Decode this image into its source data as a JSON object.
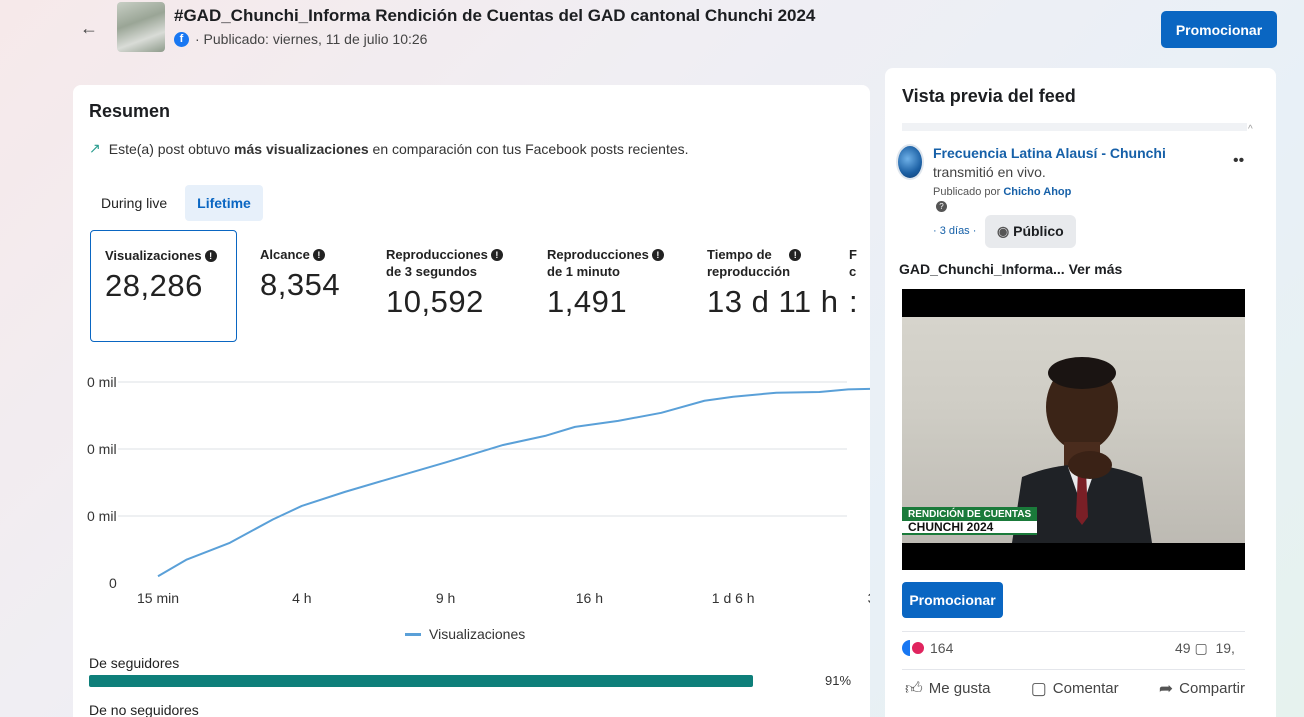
{
  "header": {
    "title": "#GAD_Chunchi_Informa Rendición de Cuentas del GAD cantonal Chunchi 2024",
    "subtitle": "· Publicado: viernes, 11 de julio 10:26",
    "back_icon": "arrow-left-icon",
    "promote_label": "Promocionar"
  },
  "summary": {
    "title": "Resumen",
    "insight_prefix": "Este(a) post obtuvo ",
    "insight_bold": "más visualizaciones",
    "insight_suffix": " en comparación con tus Facebook posts recientes.",
    "tabs": [
      {
        "label": "During live",
        "active": false
      },
      {
        "label": "Lifetime",
        "active": true
      }
    ],
    "metrics": [
      {
        "label": "Visualizaciones",
        "value": "28,286"
      },
      {
        "label": "Alcance",
        "value": "8,354"
      },
      {
        "label": "Reproducciones de 3 segundos",
        "line1": "Reproducciones",
        "line2": "de 3 segundos",
        "value": "10,592"
      },
      {
        "label": "Reproducciones de 1 minuto",
        "line1": "Reproducciones",
        "line2": "de 1 minuto",
        "value": "1,491"
      },
      {
        "label": "Tiempo de reproducción",
        "line1": "Tiempo de",
        "line2": "reproducción",
        "value": "13 d 11 h"
      },
      {
        "label": "F",
        "line1": "F",
        "line2": "c",
        "value": ":"
      }
    ],
    "followers_label": "De seguidores",
    "followers_pct_value": 91,
    "followers_pct_text": "91%",
    "non_followers_label": "De no seguidores"
  },
  "chart_data": {
    "type": "line",
    "ytick_labels": [
      "0",
      "0 mil",
      "0 mil",
      "0 mil"
    ],
    "ytick_values": [
      0,
      10000,
      20000,
      30000
    ],
    "ylim": [
      0,
      30000
    ],
    "xtick_labels": [
      "15 min",
      "4 h",
      "9 h",
      "16 h",
      "1 d 6 h",
      "3 c"
    ],
    "xtick_positions": [
      0,
      1,
      2,
      3,
      4,
      5
    ],
    "x": [
      0,
      0.2,
      0.5,
      0.8,
      1.0,
      1.3,
      1.6,
      2.0,
      2.4,
      2.7,
      2.9,
      3.2,
      3.5,
      3.8,
      4.0,
      4.3,
      4.6,
      4.8,
      5.0
    ],
    "y": [
      1000,
      3500,
      6000,
      9500,
      11500,
      13600,
      15500,
      18000,
      20600,
      22000,
      23300,
      24200,
      25400,
      27200,
      27800,
      28400,
      28500,
      28900,
      29000
    ],
    "series": [
      {
        "name": "Visualizaciones",
        "color": "#5aa0d8"
      }
    ],
    "grid": true,
    "legend_position": "bottom"
  },
  "feed": {
    "title": "Vista previa del feed",
    "page_name": "Frecuencia Latina Alausí - Chunchi",
    "live_text": "transmitió en vivo.",
    "published_by_prefix": "Publicado por ",
    "published_by_name": "Chicho Ahop",
    "age": "· 3 días ·",
    "audience": "Público",
    "caption": "GAD_Chunchi_Informa...",
    "see_more": "Ver más",
    "banner_line1": "RENDICIÓN DE CUENTAS",
    "banner_line2": "CHUNCHI 2024",
    "promote_label": "Promocionar",
    "reactions_count": "164",
    "comments_count": "49",
    "shares_count": "19,",
    "like_label": "Me gusta",
    "comment_label": "Comentar",
    "share_label": "Compartir"
  },
  "colors": {
    "accent": "#0a66c2",
    "line": "#5aa0d8",
    "bar": "#0e7f7a"
  }
}
